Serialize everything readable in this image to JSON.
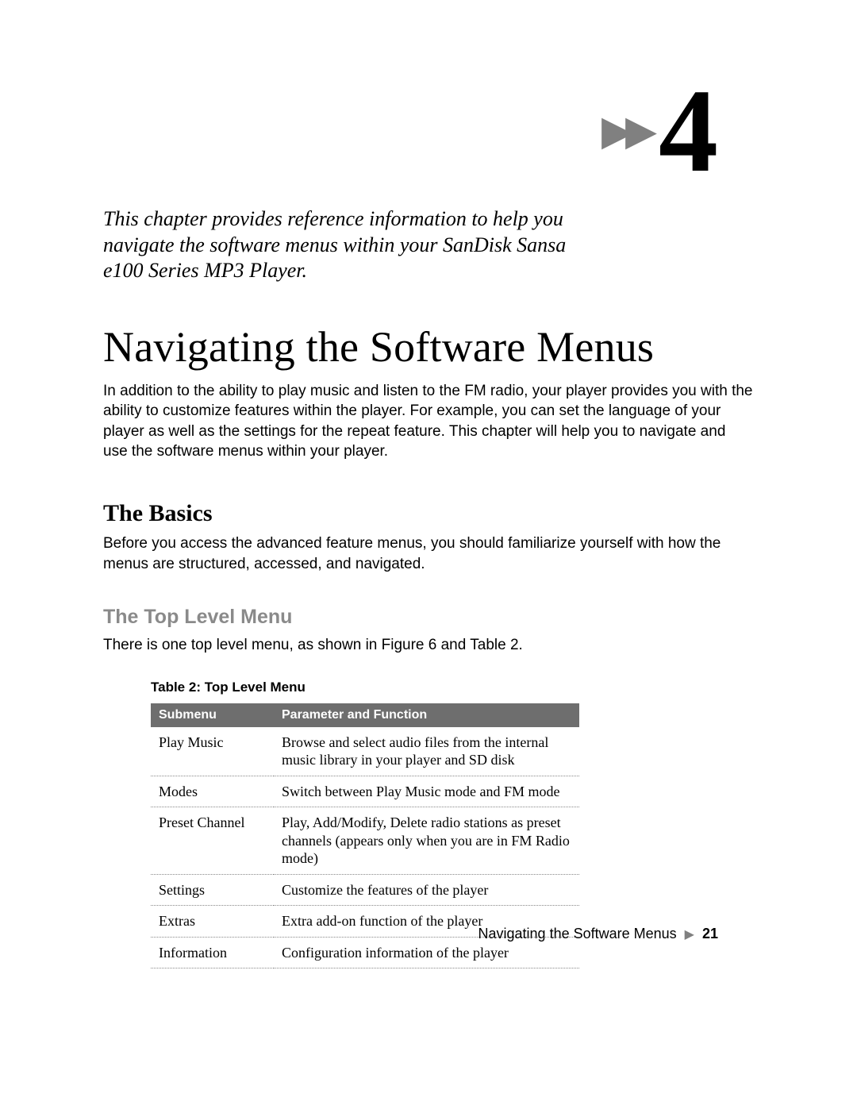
{
  "chapter_number": "4",
  "intro": "This chapter provides reference information to help you navigate the software menus within your SanDisk Sansa e100 Series MP3 Player.",
  "title": "Navigating the Software Menus",
  "para1": "In addition to the ability to play music and listen to the FM radio, your player provides you with the ability to customize features within the player. For example, you can set the language of your player as well as the settings for the repeat feature. This chapter will help you to navigate and use the software menus within your player.",
  "section_basics": "The Basics",
  "basics_para": "Before you access the advanced feature menus, you should familiarize yourself with how the menus are structured, accessed, and navigated.",
  "section_top": "The Top Level Menu",
  "top_para": "There is one top level menu, as shown in Figure 6 and Table 2.",
  "table_caption": "Table 2: Top Level Menu",
  "table_headers": {
    "col1": "Submenu",
    "col2": "Parameter and Function"
  },
  "rows": [
    {
      "sub": "Play Music",
      "desc": "Browse and select audio files from the internal music library in your player and SD disk"
    },
    {
      "sub": "Modes",
      "desc": "Switch between Play Music mode and FM mode"
    },
    {
      "sub": "Preset Channel",
      "desc": "Play, Add/Modify, Delete radio stations as preset channels (appears only when you are in FM Radio mode)"
    },
    {
      "sub": "Settings",
      "desc": "Customize the features of the player"
    },
    {
      "sub": "Extras",
      "desc": "Extra add-on function of the player"
    },
    {
      "sub": "Information",
      "desc": "Configuration information of the player"
    }
  ],
  "footer_text": "Navigating the Software Menus",
  "page_number": "21"
}
